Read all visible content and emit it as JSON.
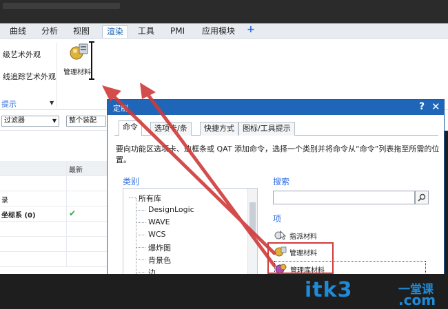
{
  "ribbon": {
    "tabs": [
      "曲线",
      "分析",
      "视图",
      "渲染",
      "工具",
      "PMI",
      "应用模块",
      "+"
    ],
    "active_tab": "渲染",
    "left_items": [
      "级艺术外观",
      "线追踪艺术外观"
    ],
    "hint_label": "提示",
    "material_button": "管理材料"
  },
  "filter_row": {
    "filter_select": "过滤器",
    "assembly_select": "整个装配"
  },
  "grid": {
    "header_col2": "最新",
    "rows": [
      "",
      "",
      "",
      "录",
      "坐标系 (0)",
      "",
      "",
      ""
    ]
  },
  "dialog": {
    "title": "定制",
    "help": "?",
    "close": "✕",
    "tabs": [
      "命令",
      "选项卡/条",
      "快捷方式",
      "图标/工具提示"
    ],
    "description": "要向功能区选项卡、边框条或 QAT 添加命令，选择一个类别并将命令从“命令”列表拖至所需的位置。",
    "category_label": "类别",
    "categories": [
      "所有库",
      "DesignLogic",
      "WAVE",
      "WCS",
      "爆炸图",
      "背景色",
      "边"
    ],
    "search_label": "搜索",
    "search_value": "",
    "items_label": "项",
    "items": [
      "指派材料",
      "管理材料",
      "管理库材料"
    ]
  },
  "watermark": {
    "main": "itk3",
    "cn": "一堂课",
    "com": ".com"
  },
  "colors": {
    "accent": "#1f66b8",
    "arrow": "#d03a3a",
    "check": "#27a844"
  }
}
